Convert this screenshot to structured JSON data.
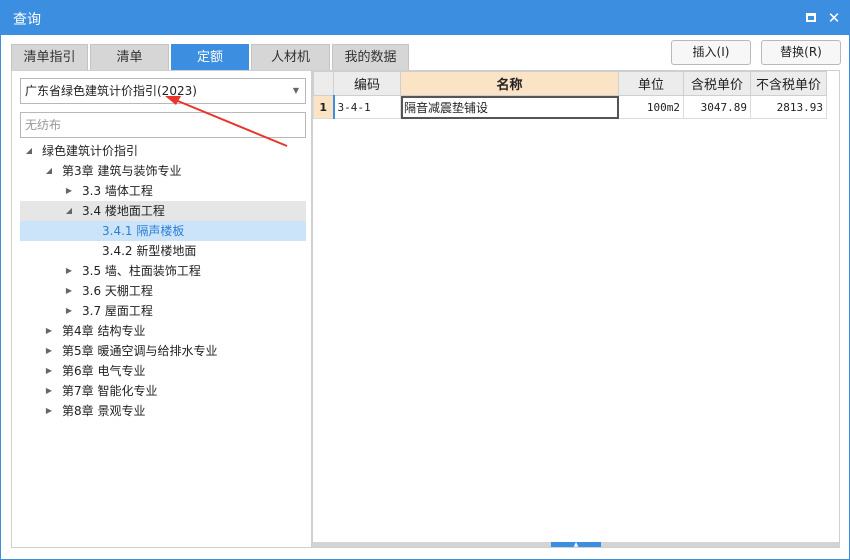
{
  "window": {
    "title": "查询"
  },
  "tabs": [
    {
      "label": "清单指引",
      "active": false
    },
    {
      "label": "清单",
      "active": false
    },
    {
      "label": "定额",
      "active": true
    },
    {
      "label": "人材机",
      "active": false
    },
    {
      "label": "我的数据",
      "active": false
    }
  ],
  "buttons": {
    "insert": "插入(I)",
    "replace": "替换(R)"
  },
  "library_select": {
    "value": "广东省绿色建筑计价指引(2023)"
  },
  "search": {
    "placeholder": "无纺布"
  },
  "tree": [
    {
      "label": "绿色建筑计价指引",
      "level": 0,
      "toggle": "expanded"
    },
    {
      "label": "第3章 建筑与装饰专业",
      "level": 1,
      "toggle": "expanded"
    },
    {
      "label": "3.3 墙体工程",
      "level": 2,
      "toggle": "collapsed"
    },
    {
      "label": "3.4 楼地面工程",
      "level": 2,
      "toggle": "expanded",
      "state": "hover"
    },
    {
      "label": "3.4.1 隔声楼板",
      "level": 3,
      "toggle": "none",
      "state": "selected"
    },
    {
      "label": "3.4.2 新型楼地面",
      "level": 3,
      "toggle": "none"
    },
    {
      "label": "3.5 墙、柱面装饰工程",
      "level": 2,
      "toggle": "collapsed"
    },
    {
      "label": "3.6 天棚工程",
      "level": 2,
      "toggle": "collapsed"
    },
    {
      "label": "3.7 屋面工程",
      "level": 2,
      "toggle": "collapsed"
    },
    {
      "label": "第4章 结构专业",
      "level": 1,
      "toggle": "collapsed"
    },
    {
      "label": "第5章 暖通空调与给排水专业",
      "level": 1,
      "toggle": "collapsed"
    },
    {
      "label": "第6章 电气专业",
      "level": 1,
      "toggle": "collapsed"
    },
    {
      "label": "第7章 智能化专业",
      "level": 1,
      "toggle": "collapsed"
    },
    {
      "label": "第8章 景观专业",
      "level": 1,
      "toggle": "collapsed"
    }
  ],
  "grid": {
    "columns": [
      "编码",
      "名称",
      "单位",
      "含税单价",
      "不含税单价"
    ],
    "rows": [
      {
        "index": "1",
        "code": "3-4-1",
        "name": "隔音减震垫铺设",
        "unit": "100m2",
        "price_with_tax": "3047.89",
        "price_without_tax": "2813.93"
      }
    ]
  },
  "colors": {
    "accent": "#3b8ee0",
    "header_highlight": "#fbe3c6",
    "selected_row": "#cce4fa",
    "annotation_arrow": "#e8352c"
  },
  "icons": {
    "restore": "restore-icon",
    "close": "close-icon",
    "dropdown": "chevron-down-icon",
    "expanded": "triangle-down-icon",
    "collapsed": "triangle-right-icon"
  }
}
